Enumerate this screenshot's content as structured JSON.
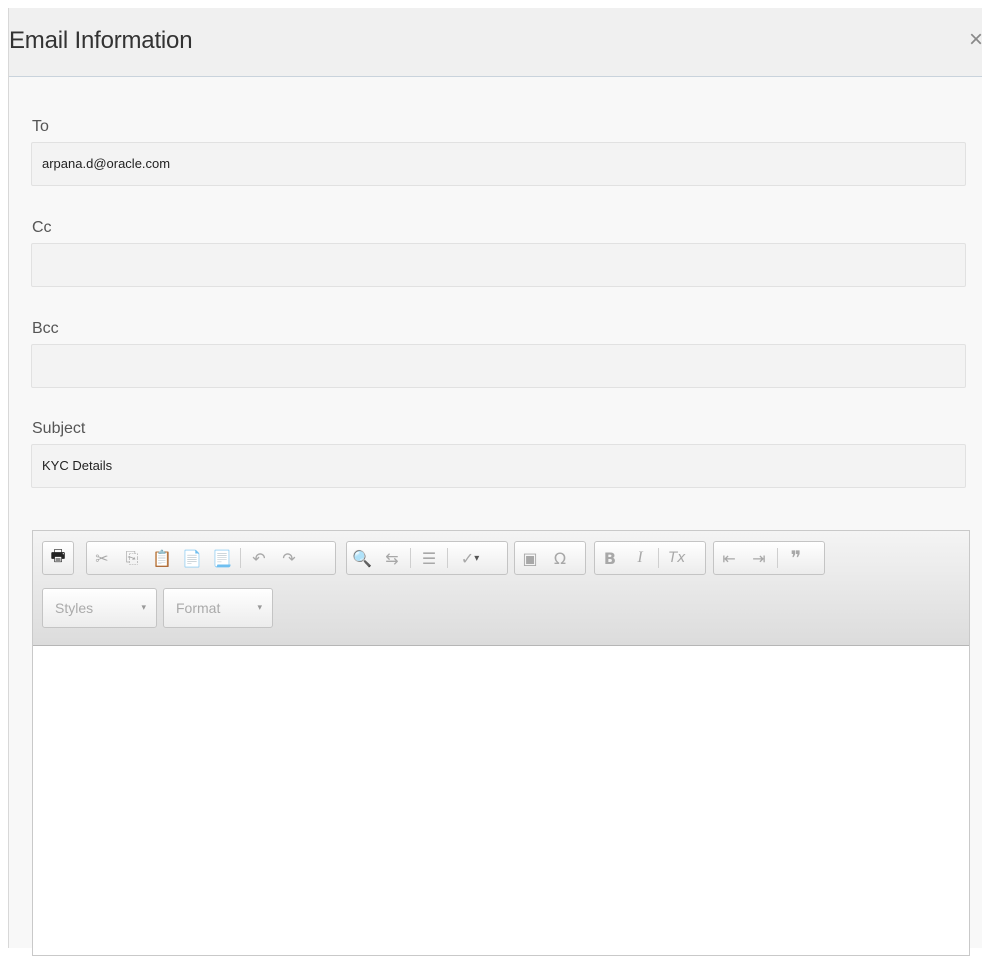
{
  "dialog": {
    "title": "Email Information",
    "close_glyph": "×"
  },
  "form": {
    "to": {
      "label": "To",
      "value": "arpana.d@oracle.com"
    },
    "cc": {
      "label": "Cc",
      "value": ""
    },
    "bcc": {
      "label": "Bcc",
      "value": ""
    },
    "subject": {
      "label": "Subject",
      "value": "KYC Details"
    }
  },
  "editor": {
    "toolbar": {
      "styles_label": "Styles",
      "format_label": "Format",
      "icons": {
        "print": "🖶",
        "cut": "✂",
        "copy": "⎘",
        "paste": "📋",
        "paste_text": "📄",
        "paste_word": "📃",
        "undo": "↶",
        "redo": "↷",
        "find": "🔍",
        "replace": "⇆",
        "select_all": "☰",
        "spellcheck": "✓",
        "image": "▣",
        "special_char": "Ω",
        "bold": "B",
        "italic": "I",
        "remove_format": "Tx",
        "outdent": "⇤",
        "indent": "⇥",
        "blockquote": "❞",
        "dropdown": "▾"
      }
    }
  }
}
